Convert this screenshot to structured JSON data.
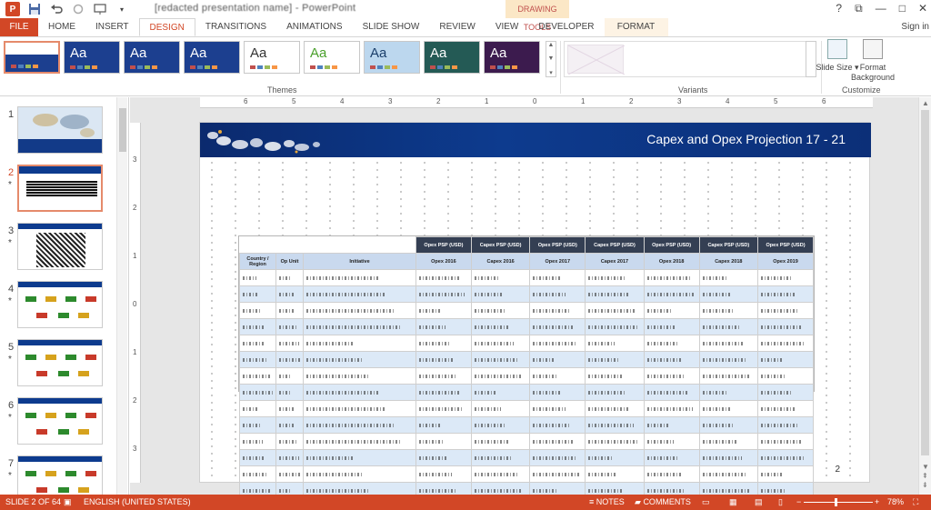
{
  "titlebar": {
    "doc_title": "[redacted presentation name] - PowerPoint",
    "context_tab_group": "DRAWING TOOLS",
    "window_controls": [
      "?",
      "⧉",
      "—",
      "□",
      "✕"
    ]
  },
  "tabs": [
    "FILE",
    "HOME",
    "INSERT",
    "DESIGN",
    "TRANSITIONS",
    "ANIMATIONS",
    "SLIDE SHOW",
    "REVIEW",
    "VIEW",
    "DEVELOPER",
    "FORMAT"
  ],
  "active_tab": "DESIGN",
  "signin": "Sign in",
  "ribbon": {
    "themes_label": "Themes",
    "variants_label": "Variants",
    "customize_label": "Customize",
    "slide_size": "Slide Size",
    "format_background": "Format Background",
    "themes": [
      {
        "name": "current-theme",
        "aa": "",
        "bg": "#1c3f8f",
        "fg": "#ffffff"
      },
      {
        "name": "blue-theme-1",
        "aa": "Aa",
        "bg": "#1c3f8f",
        "fg": "#ffffff"
      },
      {
        "name": "blue-theme-2",
        "aa": "Aa",
        "bg": "#1c3f8f",
        "fg": "#ffffff"
      },
      {
        "name": "blue-theme-3",
        "aa": "Aa",
        "bg": "#1c3f8f",
        "fg": "#ffffff"
      },
      {
        "name": "office-theme",
        "aa": "Aa",
        "bg": "#ffffff",
        "fg": "#333333"
      },
      {
        "name": "facet-theme",
        "aa": "Aa",
        "bg": "#ffffff",
        "fg": "#4aa02c"
      },
      {
        "name": "pattern-theme",
        "aa": "Aa",
        "bg": "#bcd7ee",
        "fg": "#1b3f6b"
      },
      {
        "name": "ion-theme",
        "aa": "Aa",
        "bg": "#245a55",
        "fg": "#ffffff"
      },
      {
        "name": "purple-theme",
        "aa": "Aa",
        "bg": "#3c1b4e",
        "fg": "#ffffff"
      }
    ]
  },
  "rulers": {
    "h_ticks": [
      "6",
      "5",
      "4",
      "3",
      "2",
      "1",
      "0",
      "1",
      "2",
      "3",
      "4",
      "5",
      "6"
    ],
    "v_ticks": [
      "3",
      "2",
      "1",
      "0",
      "1",
      "2",
      "3"
    ]
  },
  "slides": [
    {
      "num": "1",
      "star": "",
      "kind": "map"
    },
    {
      "num": "2",
      "star": "*",
      "kind": "table",
      "selected": true
    },
    {
      "num": "3",
      "star": "*",
      "kind": "dense"
    },
    {
      "num": "4",
      "star": "*",
      "kind": "cars"
    },
    {
      "num": "5",
      "star": "*",
      "kind": "cars"
    },
    {
      "num": "6",
      "star": "*",
      "kind": "cars"
    },
    {
      "num": "7",
      "star": "*",
      "kind": "cars"
    }
  ],
  "slide": {
    "title": "Capex and Opex Projection 17 - 21",
    "page_number": "2",
    "table": {
      "group_headers": [
        "Opex PSP (USD)",
        "Capex PSP (USD)",
        "Opex PSP (USD)",
        "Capex PSP (USD)",
        "Opex PSP (USD)",
        "Capex PSP (USD)",
        "Opex PSP (USD)"
      ],
      "col_headers": [
        "Country / Region",
        "Op Unit",
        "Initiative",
        "Opex 2016",
        "Capex 2016",
        "Opex 2017",
        "Capex 2017",
        "Opex 2018",
        "Capex 2018",
        "Opex 2019"
      ]
    }
  },
  "statusbar": {
    "slide_info": "SLIDE 2 OF 64",
    "language": "ENGLISH (UNITED STATES)",
    "notes": "NOTES",
    "comments": "COMMENTS",
    "zoom_minus": "−",
    "zoom_plus": "+",
    "zoom": "78%"
  },
  "colors": {
    "accent": "#d24726",
    "slide_header": "#0d3b8e",
    "table_header_dark": "#343f53",
    "table_header_light": "#c9d9ee",
    "stripe": "#dce9f7"
  }
}
